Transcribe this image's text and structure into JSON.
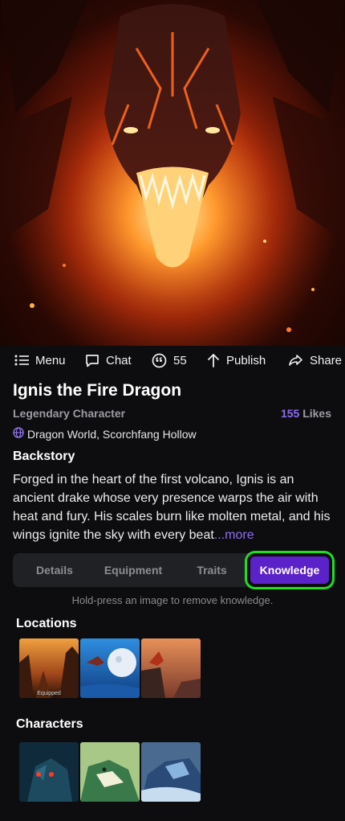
{
  "toolbar": {
    "menu_label": "Menu",
    "chat_label": "Chat",
    "comments_count": "55",
    "publish_label": "Publish",
    "share_label": "Share"
  },
  "character": {
    "name": "Ignis the Fire Dragon",
    "category": "Legendary Character",
    "likes_count": "155",
    "likes_label": "Likes",
    "world": "Dragon World, Scorchfang Hollow"
  },
  "backstory": {
    "heading": "Backstory",
    "text": "Forged in the heart of the first volcano, Ignis is an ancient drake whose very presence warps the air with heat and fury. His scales burn like molten metal, and his wings ignite the sky with every beat",
    "more_label": "...more"
  },
  "tabs": {
    "items": [
      "Details",
      "Equipment",
      "Traits",
      "Knowledge"
    ],
    "active": "Knowledge"
  },
  "hint": "Hold-press an image to remove knowledge.",
  "knowledge": {
    "locations_heading": "Locations",
    "locations_badge": "Equipped",
    "characters_heading": "Characters"
  },
  "colors": {
    "accent": "#8e6bf4",
    "active_tab": "#5b22c9",
    "highlight": "#22dd22",
    "background": "#0d0d0f"
  }
}
